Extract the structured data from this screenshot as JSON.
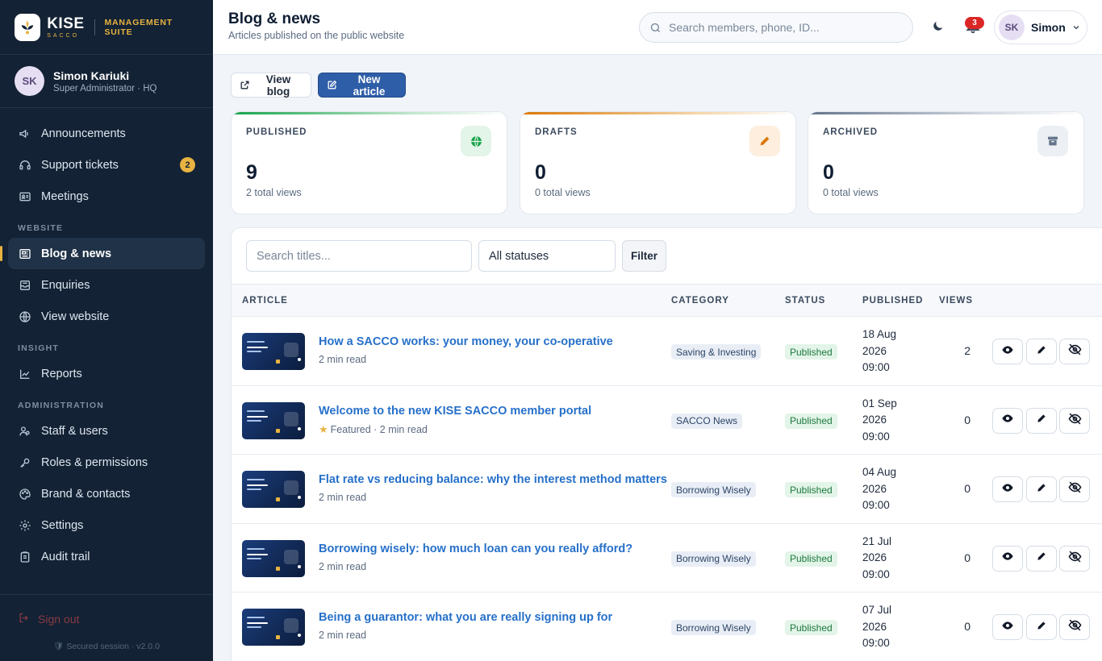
{
  "brand": {
    "name": "KISE",
    "sub": "SACCO",
    "suite": "MANAGEMENT SUITE"
  },
  "user": {
    "initials": "SK",
    "name": "Simon Kariuki",
    "role": "Super Administrator · HQ",
    "short_name": "Simon"
  },
  "nav": {
    "top": [
      {
        "label": "Announcements",
        "icon": "megaphone-icon"
      },
      {
        "label": "Support tickets",
        "icon": "headset-icon",
        "badge": "2"
      },
      {
        "label": "Meetings",
        "icon": "meeting-icon"
      }
    ],
    "website_label": "WEBSITE",
    "website": [
      {
        "label": "Blog & news",
        "icon": "newspaper-icon",
        "active": true
      },
      {
        "label": "Enquiries",
        "icon": "inbox-icon"
      },
      {
        "label": "View website",
        "icon": "globe-icon"
      }
    ],
    "insight_label": "INSIGHT",
    "insight": [
      {
        "label": "Reports",
        "icon": "chart-line-icon"
      }
    ],
    "admin_label": "ADMINISTRATION",
    "admin": [
      {
        "label": "Staff & users",
        "icon": "users-icon"
      },
      {
        "label": "Roles & permissions",
        "icon": "key-icon"
      },
      {
        "label": "Brand & contacts",
        "icon": "palette-icon"
      },
      {
        "label": "Settings",
        "icon": "gear-icon"
      },
      {
        "label": "Audit trail",
        "icon": "clipboard-icon"
      }
    ],
    "signout": "Sign out",
    "secured": "Secured session · v2.0.0"
  },
  "header": {
    "title": "Blog & news",
    "subtitle": "Articles published on the public website",
    "search_placeholder": "Search members, phone, ID...",
    "notifications": "3"
  },
  "actions": {
    "view_blog": "View blog",
    "new_article": "New article"
  },
  "stats": [
    {
      "label": "PUBLISHED",
      "value": "9",
      "meta": "2 total views",
      "icon": "globe-icon",
      "color": "#16a34a",
      "bg": "#e3f4e8"
    },
    {
      "label": "DRAFTS",
      "value": "0",
      "meta": "0 total views",
      "icon": "pencil-icon",
      "color": "#d97706",
      "bg": "#fdeede"
    },
    {
      "label": "ARCHIVED",
      "value": "0",
      "meta": "0 total views",
      "icon": "archive-icon",
      "color": "#64748b",
      "bg": "#eceff3"
    }
  ],
  "filters": {
    "search_placeholder": "Search titles...",
    "status_value": "All statuses",
    "filter_label": "Filter"
  },
  "table": {
    "headers": {
      "article": "ARTICLE",
      "category": "CATEGORY",
      "status": "STATUS",
      "published": "PUBLISHED",
      "views": "VIEWS"
    },
    "rows": [
      {
        "title": "How a SACCO works: your money, your co-operative",
        "meta": "2 min read",
        "featured": false,
        "category": "Saving & Investing",
        "status": "Published",
        "date": "18 Aug",
        "year": "2026",
        "time": "09:00",
        "views": "2"
      },
      {
        "title": "Welcome to the new KISE SACCO member portal",
        "meta": "Featured · 2 min read",
        "featured": true,
        "category": "SACCO News",
        "status": "Published",
        "date": "01 Sep",
        "year": "2026",
        "time": "09:00",
        "views": "0"
      },
      {
        "title": "Flat rate vs reducing balance: why the interest method matters",
        "meta": "2 min read",
        "featured": false,
        "category": "Borrowing Wisely",
        "status": "Published",
        "date": "04 Aug",
        "year": "2026",
        "time": "09:00",
        "views": "0"
      },
      {
        "title": "Borrowing wisely: how much loan can you really afford?",
        "meta": "2 min read",
        "featured": false,
        "category": "Borrowing Wisely",
        "status": "Published",
        "date": "21 Jul",
        "year": "2026",
        "time": "09:00",
        "views": "0"
      },
      {
        "title": "Being a guarantor: what you are really signing up for",
        "meta": "2 min read",
        "featured": false,
        "category": "Borrowing Wisely",
        "status": "Published",
        "date": "07 Jul",
        "year": "2026",
        "time": "09:00",
        "views": "0"
      }
    ]
  }
}
